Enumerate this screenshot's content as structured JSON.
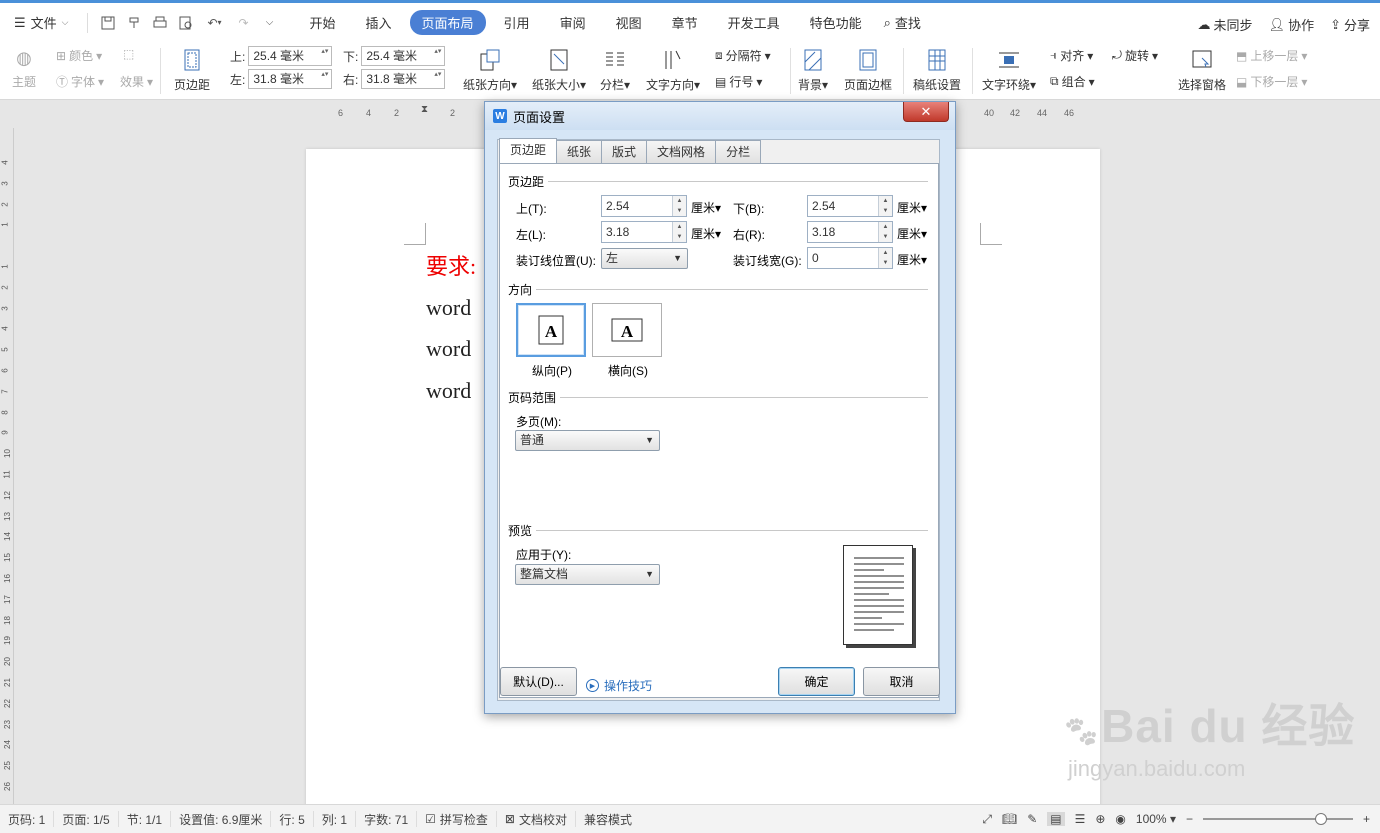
{
  "menubar": {
    "file_label": "文件",
    "tabs": [
      "开始",
      "插入",
      "页面布局",
      "引用",
      "审阅",
      "视图",
      "章节",
      "开发工具",
      "特色功能"
    ],
    "active_tab": "页面布局",
    "search_label": "查找",
    "sync_label": "未同步",
    "collab_label": "协作",
    "share_label": "分享"
  },
  "ribbon": {
    "theme": "主题",
    "color": "颜色",
    "font": "字体",
    "effect": "效果",
    "margins": "页边距",
    "top_label": "上:",
    "top_value": "25.4 毫米",
    "bottom_label": "下:",
    "bottom_value": "25.4 毫米",
    "left_label": "左:",
    "left_value": "31.8 毫米",
    "right_label": "右:",
    "right_value": "31.8 毫米",
    "orientation": "纸张方向",
    "size": "纸张大小",
    "columns": "分栏",
    "text_dir": "文字方向",
    "breaks": "分隔符",
    "line_num": "行号",
    "background": "背景",
    "page_border": "页面边框",
    "manuscript": "稿纸设置",
    "wrap": "文字环绕",
    "align": "对齐",
    "rotate": "旋转",
    "group": "组合",
    "select_pane": "选择窗格",
    "bring_forward": "上移一层",
    "send_backward": "下移一层"
  },
  "ruler": {
    "numbers": [
      "6",
      "4",
      "2",
      "2",
      "40",
      "42",
      "44",
      "46"
    ]
  },
  "document": {
    "line1": "要求:",
    "line2": "word",
    "line3": "word",
    "line4": "word"
  },
  "dialog": {
    "title": "页面设置",
    "tabs": [
      "页边距",
      "纸张",
      "版式",
      "文档网格",
      "分栏"
    ],
    "active_tab": "页边距",
    "margins_section": "页边距",
    "top_label": "上(T):",
    "top_value": "2.54",
    "bottom_label": "下(B):",
    "bottom_value": "2.54",
    "left_label": "左(L):",
    "left_value": "3.18",
    "right_label": "右(R):",
    "right_value": "3.18",
    "gutter_pos_label": "装订线位置(U):",
    "gutter_pos_value": "左",
    "gutter_width_label": "装订线宽(G):",
    "gutter_width_value": "0",
    "unit": "厘米",
    "orientation_section": "方向",
    "portrait_label": "纵向(P)",
    "landscape_label": "横向(S)",
    "pages_section": "页码范围",
    "multi_label": "多页(M):",
    "multi_value": "普通",
    "preview_section": "预览",
    "apply_label": "应用于(Y):",
    "apply_value": "整篇文档",
    "default_btn": "默认(D)...",
    "tips_label": "操作技巧",
    "ok_btn": "确定",
    "cancel_btn": "取消"
  },
  "status": {
    "page_num": "页码: 1",
    "pages": "页面: 1/5",
    "section": "节: 1/1",
    "setting": "设置值: 6.9厘米",
    "row": "行: 5",
    "col": "列: 1",
    "words": "字数: 71",
    "spell": "拼写检查",
    "doc_check": "文档校对",
    "compat": "兼容模式",
    "zoom": "100%"
  },
  "watermark": {
    "brand": "Bai du 经验",
    "url": "jingyan.baidu.com"
  }
}
